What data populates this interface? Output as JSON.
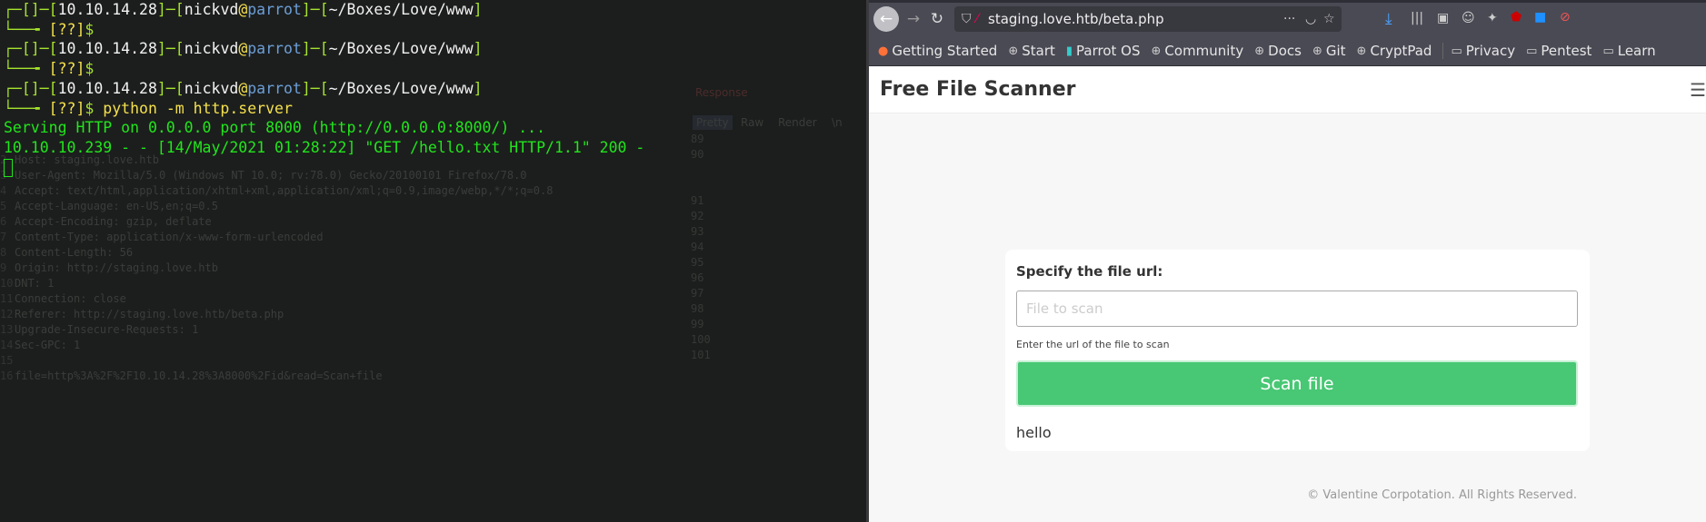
{
  "terminal": {
    "prompts": [
      {
        "ip": "10.10.14.28",
        "user": "nickvd",
        "host": "parrot",
        "path": "~/Boxes/Love/www",
        "status": "??",
        "command": ""
      },
      {
        "ip": "10.10.14.28",
        "user": "nickvd",
        "host": "parrot",
        "path": "~/Boxes/Love/www",
        "status": "??",
        "command": ""
      },
      {
        "ip": "10.10.14.28",
        "user": "nickvd",
        "host": "parrot",
        "path": "~/Boxes/Love/www",
        "status": "??",
        "command": "python -m http.server"
      }
    ],
    "output": [
      "Serving HTTP on 0.0.0.0 port 8000 (http://0.0.0.0:8000/) ...",
      "10.10.10.239 - - [14/May/2021 01:28:22] \"GET /hello.txt HTTP/1.1\" 200 -"
    ],
    "background_burp": {
      "tabs": [
        "Response",
        "Pretty",
        "Raw",
        "Render",
        "\\n"
      ],
      "request_lines": [
        "Host: staging.love.htb",
        "User-Agent: Mozilla/5.0 (Windows NT 10.0; rv:78.0) Gecko/20100101 Firefox/78.0",
        "Accept: text/html,application/xhtml+xml,application/xml;q=0.9,image/webp,*/*;q=0.8",
        "Accept-Language: en-US,en;q=0.5",
        "Accept-Encoding: gzip, deflate",
        "Content-Type: application/x-www-form-urlencoded",
        "Content-Length: 56",
        "Origin: http://staging.love.htb",
        "DNT: 1",
        "Connection: close",
        "Referer: http://staging.love.htb/beta.php",
        "Upgrade-Insecure-Requests: 1",
        "Sec-GPC: 1",
        "",
        "file=http%3A%2F%2F10.10.14.28%3A8000%2Fid&read=Scan+file"
      ],
      "response_line_numbers": [
        "89",
        "90",
        "91",
        "92",
        "93",
        "94",
        "95",
        "96",
        "97",
        "98",
        "99",
        "100",
        "101"
      ]
    }
  },
  "browser": {
    "url": "staging.love.htb/beta.php",
    "bookmarks": [
      {
        "label": "Getting Started",
        "icon": "firefox-icon"
      },
      {
        "label": "Start",
        "icon": "globe-icon"
      },
      {
        "label": "Parrot OS",
        "icon": "parrot-icon"
      },
      {
        "label": "Community",
        "icon": "globe-icon"
      },
      {
        "label": "Docs",
        "icon": "globe-icon"
      },
      {
        "label": "Git",
        "icon": "globe-icon"
      },
      {
        "label": "CryptPad",
        "icon": "globe-icon"
      },
      {
        "label": "Privacy",
        "icon": "folder-icon"
      },
      {
        "label": "Pentest",
        "icon": "folder-icon"
      },
      {
        "label": "Learn",
        "icon": "folder-icon"
      }
    ]
  },
  "page": {
    "title": "Free File Scanner",
    "label": "Specify the file url:",
    "input_value": "",
    "input_placeholder": "File to scan",
    "help": "Enter the url of the file to scan",
    "button": "Scan file",
    "result": "hello",
    "footer": "© Valentine Corpotation. All Rights Reserved.",
    "accent": "#48c774"
  }
}
